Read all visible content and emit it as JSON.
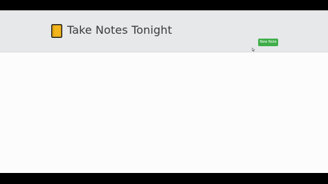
{
  "header": {
    "app_title": "Take Notes Tonight",
    "logo_icon": "notebook-icon",
    "new_note_label": "New Note"
  },
  "colors": {
    "header_bg": "#e6e8ea",
    "page_bg": "#fcfcfd",
    "accent_green": "#3fae49",
    "notebook_yellow": "#f2b51c"
  },
  "notes": []
}
